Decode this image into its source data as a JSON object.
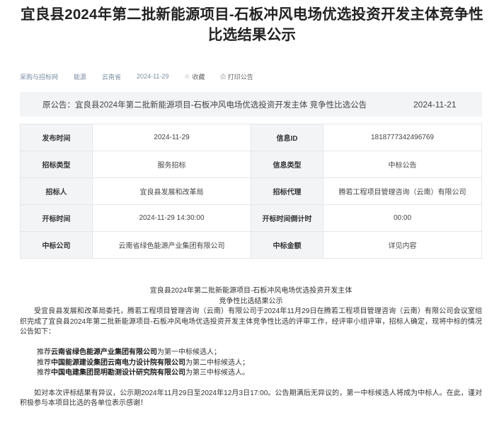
{
  "title_line1": "宜良县2024年第二批新能源项目-石板冲风电场优选投资开发主体竞争性",
  "title_line2": "比选结果公示",
  "meta": {
    "cat1": "采购与招标网",
    "cat2": "能源",
    "region": "云南省",
    "date": "2024-11-29",
    "favorite_icon": "star-icon",
    "favorite": "收藏",
    "print_icon": "print-icon",
    "print": "打印公告"
  },
  "notice": {
    "prefix": "原公告：",
    "link": "宜良县2024年第二批新能源项目-石板冲风电场优选投资开发主体 竞争性比选公告",
    "date": "2024-11-21"
  },
  "info": [
    {
      "k1": "发布时间",
      "v1": "2024-11-29",
      "k2": "信息ID",
      "v2": "1818777342496769"
    },
    {
      "k1": "招标类型",
      "v1": "服务招标",
      "k2": "信息类型",
      "v2": "中标公告"
    },
    {
      "k1": "招标人",
      "v1": "宜良县发展和改革局",
      "k2": "招标代理",
      "v2": "腾若工程项目管理咨询（云南）有限公司"
    },
    {
      "k1": "开标时间",
      "v1": "2024-11-29 14:30:00",
      "k2": "开标时间倒计时",
      "v2": "00:00"
    },
    {
      "k1": "中标公司",
      "v1": "云南省绿色能源产业集团有限公司",
      "k2": "中标金额",
      "v2": "详见内容"
    }
  ],
  "content": {
    "head1": "宜良县2024年第二批新能源项目-石板冲风电场优选投资开发主体",
    "head2": "竞争性比选结果公示",
    "para": "受宜良县发展和改革局委托，腾若工程项目管理咨询（云南）有限公司于2024年11月29日在腾若工程项目管理咨询（云南）有限公司会议室组织完成了宜良县2024年第二批新能源项目-石板冲风电场优选投资开发主体竞争性比选的评审工作，经评审小组评审，招标人确定，现将中标的情况公告如下：",
    "ranks": [
      {
        "pre": "推荐",
        "name": "云南省绿色能源产业集团有限公司",
        "post": "为第一中标候选人；"
      },
      {
        "pre": "推荐",
        "name": "中国能源建设集团云南电力设计院有限公司",
        "post": "为第二中标候选人；"
      },
      {
        "pre": "推荐",
        "name": "中国电建集团昆明勘测设计研究院有限公司",
        "post": "为第三中标候选人。"
      }
    ],
    "closing": "如对本次评标结果有异议，公示期2024年11月29日至2024年12月3日17:00。公告期满后无异议的，第一中标候选人将成为中标人。在此，谨对积极参与本项目比选的各单位表示感谢！"
  }
}
